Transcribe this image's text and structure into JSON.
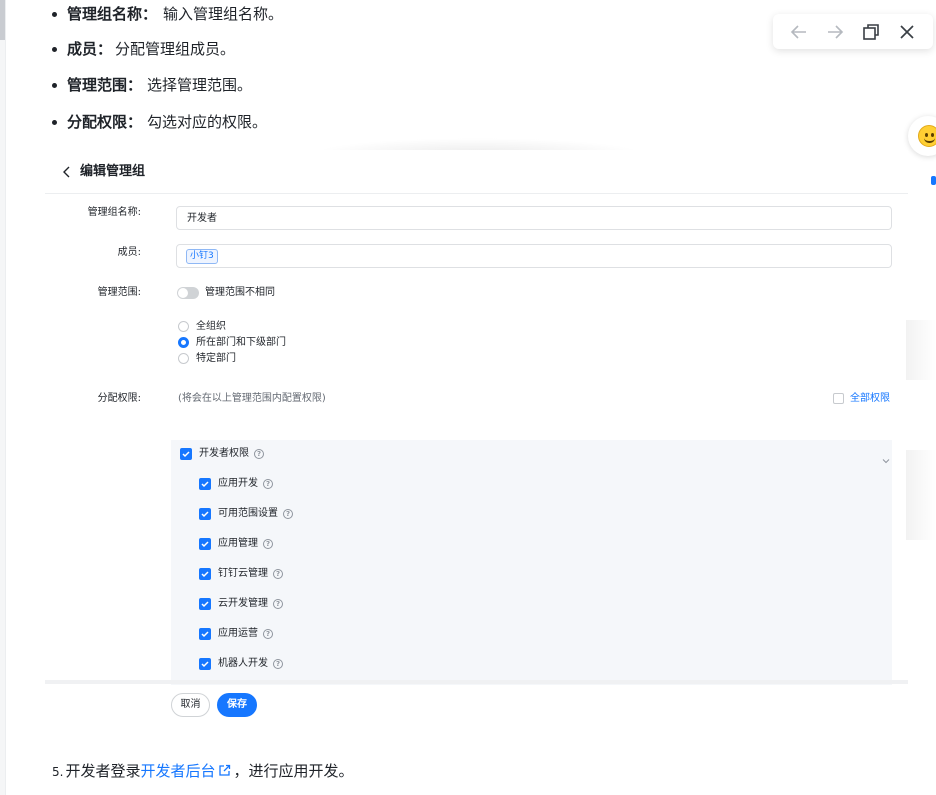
{
  "doc": {
    "bullets": [
      {
        "term": "管理组名称：",
        "desc": "输入管理组名称。"
      },
      {
        "term": "成员：",
        "desc": "分配管理组成员。"
      },
      {
        "term": "管理范围：",
        "desc": "选择管理范围。"
      },
      {
        "term": "分配权限：",
        "desc": "勾选对应的权限。"
      }
    ],
    "step": {
      "number": "5.",
      "before": "开发者登录",
      "link": "开发者后台",
      "after": "，进行应用开发。"
    }
  },
  "viewer": {
    "icons": [
      "arrow-left-icon",
      "arrow-right-icon",
      "restore-window-icon",
      "close-icon"
    ]
  },
  "screenshot": {
    "title": "编辑管理组",
    "form": {
      "name_label": "管理组名称:",
      "name_value": "开发者",
      "members_label": "成员:",
      "member_tag": "小钉3",
      "scope_label": "管理范围:",
      "scope_toggle_text": "管理范围不相同",
      "scope_toggle_on": false,
      "scope_options": [
        {
          "label": "全组织",
          "selected": false
        },
        {
          "label": "所在部门和下级部门",
          "selected": true
        },
        {
          "label": "特定部门",
          "selected": false
        }
      ],
      "perm_label": "分配权限:",
      "perm_hint": "(将会在以上管理范围内配置权限)",
      "all_perm_text": "全部权限",
      "permissions": {
        "group": "开发者权限",
        "items": [
          "应用开发",
          "可用范围设置",
          "应用管理",
          "钉钉云管理",
          "云开发管理",
          "应用运营",
          "机器人开发"
        ]
      }
    },
    "buttons": {
      "cancel": "取消",
      "save": "保存"
    }
  },
  "colors": {
    "accent": "#1677ff",
    "text": "#1f2329",
    "muted": "#646a73"
  }
}
